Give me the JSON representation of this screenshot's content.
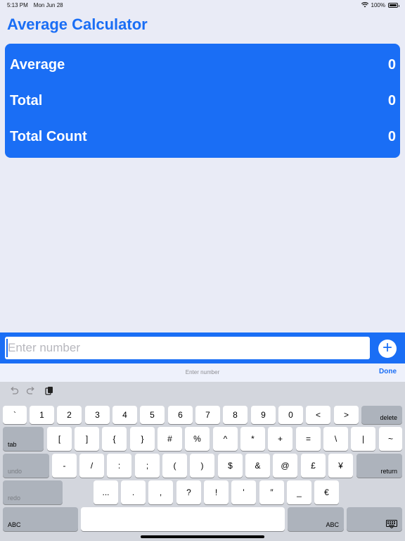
{
  "status_bar": {
    "time": "5:13 PM",
    "date": "Mon Jun 28",
    "battery": "100%"
  },
  "app": {
    "title": "Average Calculator"
  },
  "stats": [
    {
      "label": "Average",
      "value": "0"
    },
    {
      "label": "Total",
      "value": "0"
    },
    {
      "label": "Total Count",
      "value": "0"
    }
  ],
  "input": {
    "placeholder": "Enter number",
    "add_label": "+"
  },
  "accessory": {
    "title": "Enter number",
    "done_label": "Done"
  },
  "keyboard": {
    "toolbar_icons": [
      "undo-icon",
      "redo-icon",
      "clipboard-icon"
    ],
    "row1": [
      "`",
      "1",
      "2",
      "3",
      "4",
      "5",
      "6",
      "7",
      "8",
      "9",
      "0",
      "<",
      ">"
    ],
    "row1_func": "delete",
    "row2_func": "tab",
    "row2": [
      "[",
      "]",
      "{",
      "}",
      "#",
      "%",
      "^",
      "*",
      "+",
      "=",
      "\\",
      "|",
      "~"
    ],
    "row3_func_left": "undo",
    "row3": [
      "-",
      "/",
      ":",
      ";",
      "(",
      ")",
      "$",
      "&",
      "@",
      "£",
      "¥"
    ],
    "row3_func_right": "return",
    "row4_func_left": "redo",
    "row4": [
      "...",
      ".",
      ",",
      "?",
      "!",
      "'",
      "″",
      "_",
      "€"
    ],
    "row5_left": "ABC",
    "row5_right": "ABC"
  },
  "colors": {
    "accent": "#1a6ef5",
    "background": "#e9ebf6",
    "keyboard": "#d3d6dd"
  }
}
